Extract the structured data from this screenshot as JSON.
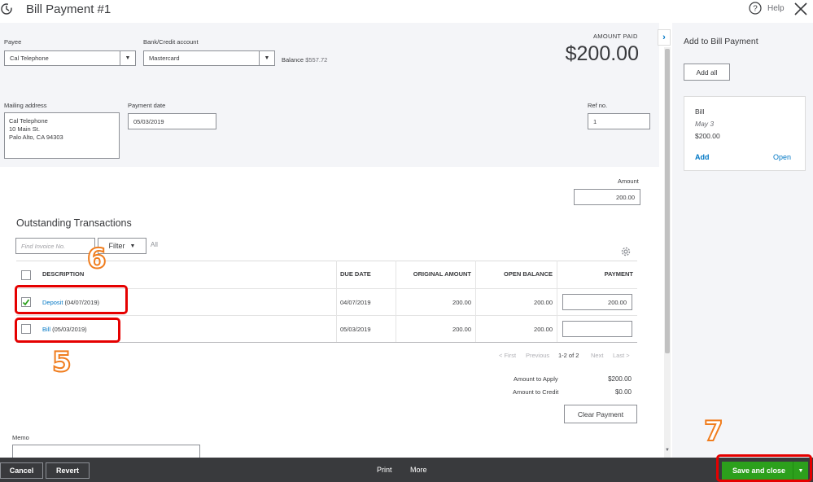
{
  "header": {
    "title": "Bill Payment  #1",
    "help_label": "Help"
  },
  "form": {
    "payee_label": "Payee",
    "payee_value": "Cal Telephone",
    "bank_label": "Bank/Credit account",
    "bank_value": "Mastercard",
    "balance_label": "Balance",
    "balance_value": "$557.72",
    "amount_paid_label": "AMOUNT PAID",
    "amount_paid_value": "$200.00",
    "mailing_label": "Mailing address",
    "mailing_lines": [
      "Cal Telephone",
      "10 Main St.",
      "Palo Alto, CA  94303"
    ],
    "payment_date_label": "Payment date",
    "payment_date_value": "05/03/2019",
    "ref_label": "Ref no.",
    "ref_value": "1",
    "amount_label": "Amount",
    "amount_value": "200.00"
  },
  "outstanding": {
    "title": "Outstanding Transactions",
    "find_placeholder": "Find Invoice No.",
    "filter_label": "Filter",
    "all_label": "All",
    "columns": [
      "DESCRIPTION",
      "DUE DATE",
      "ORIGINAL AMOUNT",
      "OPEN BALANCE",
      "PAYMENT"
    ],
    "rows": [
      {
        "link": "Deposit",
        "suffix": " (04/07/2019)",
        "due": "04/07/2019",
        "original": "200.00",
        "open": "200.00",
        "payment": "200.00",
        "checked": true
      },
      {
        "link": "Bill",
        "suffix": " (05/03/2019)",
        "due": "05/03/2019",
        "original": "200.00",
        "open": "200.00",
        "payment": "",
        "checked": false
      }
    ],
    "pager": {
      "first": "< First",
      "previous": "Previous",
      "range": "1-2 of 2",
      "next": "Next",
      "last": "Last >"
    },
    "amount_to_apply_label": "Amount to Apply",
    "amount_to_apply_value": "$200.00",
    "amount_to_credit_label": "Amount to Credit",
    "amount_to_credit_value": "$0.00",
    "clear_payment_label": "Clear Payment",
    "memo_label": "Memo"
  },
  "panel": {
    "title": "Add to Bill Payment",
    "add_all_label": "Add all",
    "card": {
      "type": "Bill",
      "date": "May 3",
      "amount": "$200.00",
      "add_label": "Add",
      "open_label": "Open"
    }
  },
  "footer": {
    "cancel": "Cancel",
    "revert": "Revert",
    "print": "Print",
    "more": "More",
    "save_close": "Save and close"
  },
  "annotations": {
    "five": "5",
    "six": "6",
    "seven": "7"
  },
  "colors": {
    "accent_green": "#2ca01c",
    "link_blue": "#0077c5",
    "annotation_red": "#e50000",
    "annotation_orange": "#f07d1e"
  }
}
